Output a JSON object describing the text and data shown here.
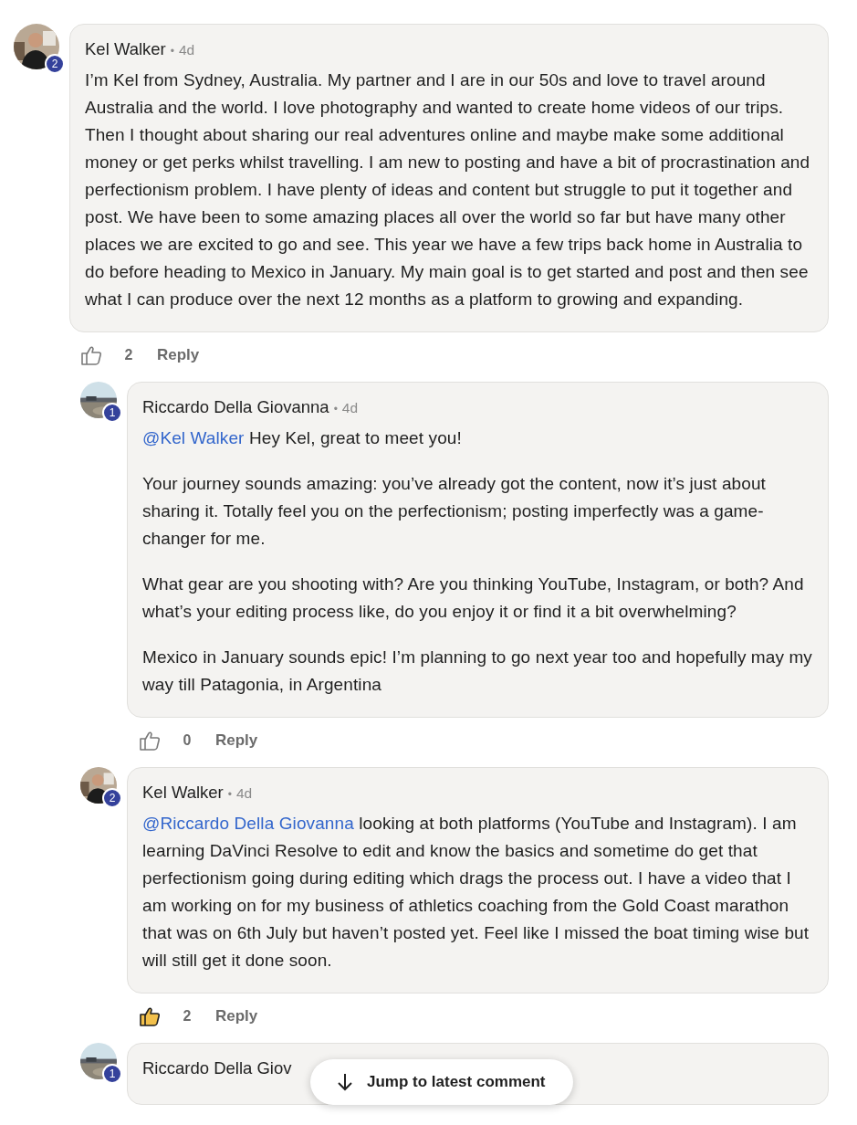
{
  "comment": {
    "author": "Kel Walker",
    "separator": "•",
    "time": "4d",
    "badge": "2",
    "paragraphs": [
      {
        "text": "I’m Kel from Sydney, Australia. My partner and I are in our 50s and love to travel around Australia and the world. I love photography and wanted to create home videos of our trips. Then I thought about sharing our real adventures online and maybe make some additional money or get perks whilst travelling. I am new to posting and have a bit of procrastination and perfectionism problem. I have plenty of ideas and content but struggle to put it together and post. We have been to some amazing places all over the world so far but have many other places we are excited to go and see. This year we have a few trips back home in Australia to do before heading to Mexico in January. My main goal is to get started and post and then see what I can produce over the next 12 months as a platform to growing and expanding."
      }
    ],
    "liked": false,
    "likes": "2",
    "reply_label": "Reply"
  },
  "replies": [
    {
      "author": "Riccardo Della Giovanna",
      "separator": "•",
      "time": "4d",
      "badge": "1",
      "paragraphs": [
        {
          "mention": "@Kel Walker",
          "text": " Hey Kel, great to meet you!"
        },
        {
          "text": "Your journey sounds amazing: you’ve already got the content, now it’s just about sharing it. Totally feel you on the perfectionism; posting imperfectly was a game-changer for me."
        },
        {
          "text": "What gear are you shooting with? Are you thinking YouTube, Instagram, or both? And what’s your editing process like, do you enjoy it or find it a bit overwhelming?"
        },
        {
          "text": "Mexico in January sounds epic! I’m planning to go next year too and hopefully may my way till Patagonia, in Argentina"
        }
      ],
      "liked": false,
      "likes": "0",
      "reply_label": "Reply"
    },
    {
      "author": "Kel Walker",
      "separator": "•",
      "time": "4d",
      "badge": "2",
      "paragraphs": [
        {
          "mention": "@Riccardo Della Giovanna",
          "text": " looking at both platforms (YouTube and Instagram). I am learning DaVinci Resolve to edit and know the basics and sometime do get that perfectionism going during editing which drags the process out. I have a video that I am working on for my business of athletics coaching from the Gold Coast marathon that was on 6th July but haven’t posted yet. Feel like I missed the boat timing wise but will still get it done soon."
        }
      ],
      "liked": true,
      "likes": "2",
      "reply_label": "Reply"
    },
    {
      "author": "Riccardo Della Giov",
      "badge": "1"
    }
  ],
  "jump_button": {
    "label": "Jump to latest comment"
  }
}
